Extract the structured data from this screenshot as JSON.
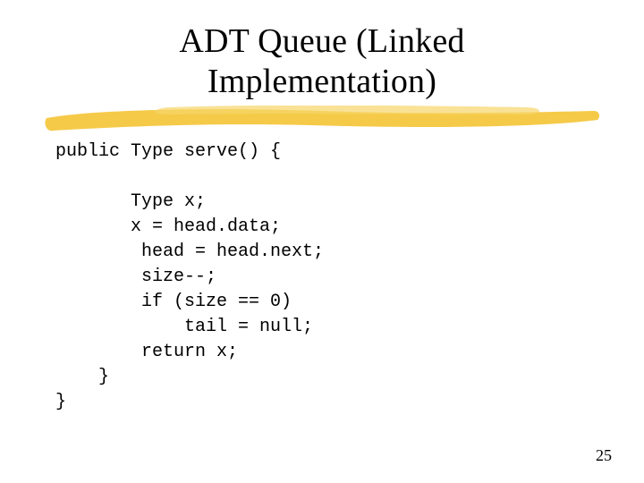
{
  "title": {
    "line1": "ADT Queue (Linked",
    "line2": "Implementation)"
  },
  "code": {
    "l1": "public Type serve() {",
    "l2": "",
    "l3": "       Type x;",
    "l4": "       x = head.data;",
    "l5": "        head = head.next;",
    "l6": "        size--;",
    "l7": "        if (size == 0)",
    "l8": "            tail = null;",
    "l9": "        return x;",
    "l10": "    }",
    "l11": "}"
  },
  "page_number": "25"
}
